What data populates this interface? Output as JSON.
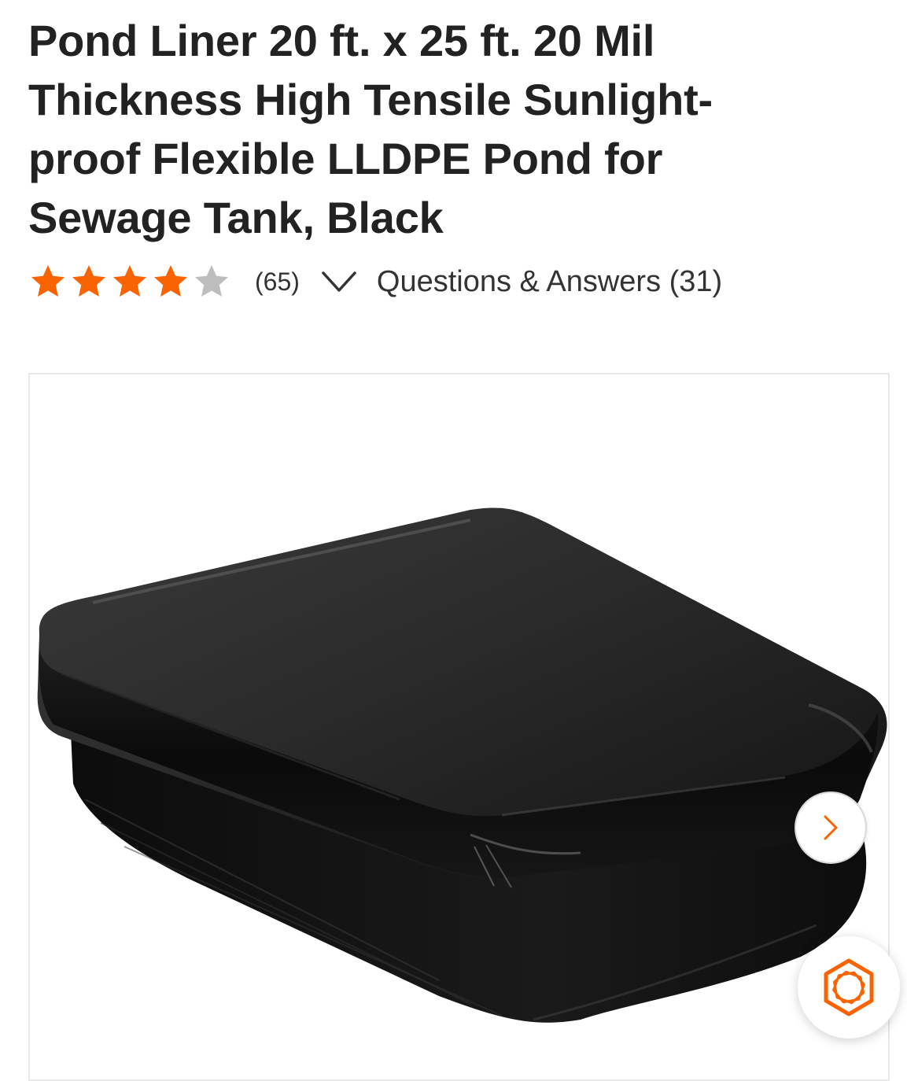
{
  "product": {
    "title": "Pond Liner 20 ft. x 25 ft. 20 Mil Thickness High Tensile Sunlight-proof Flexible LLDPE Pond for Sewage Tank, Black"
  },
  "rating": {
    "value": 4,
    "max": 5,
    "review_count": "(65)",
    "filled_color": "#f96302",
    "empty_color": "#bdbdbd"
  },
  "qa": {
    "label": "Questions & Answers (31)"
  },
  "gallery": {
    "next_icon": "chevron-right-icon",
    "assistant_icon": "hexagon-assistant-icon",
    "accent_color": "#f96302"
  }
}
